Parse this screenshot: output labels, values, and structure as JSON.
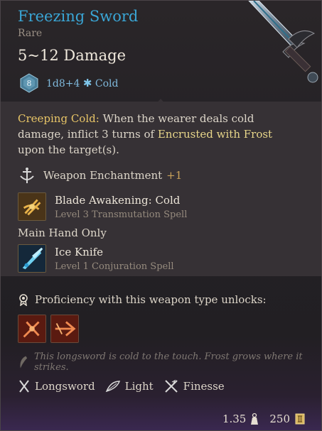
{
  "item": {
    "name": "Freezing Sword",
    "rarity": "Rare",
    "damage": "5~12 Damage",
    "die_label": "8",
    "damage_dice": "1d8+4",
    "damage_type": "Cold",
    "name_color": "#3aa6d6"
  },
  "passive": {
    "title": "Creeping Cold:",
    "text_1": " When the wearer deals cold damage, inflict 3 turns of ",
    "condition": "Encrusted with Frost",
    "text_2": " upon the target(s)."
  },
  "enchantment": {
    "label": "Weapon Enchantment",
    "bonus": "+1"
  },
  "spells": [
    {
      "name": "Blade Awakening: Cold",
      "subtitle": "Level 3 Transmutation Spell"
    },
    {
      "name": "Ice Knife",
      "subtitle": "Level 1 Conjuration Spell"
    }
  ],
  "main_hand": "Main Hand Only",
  "proficiency": {
    "label": "Proficiency with this weapon type unlocks:"
  },
  "flavor": "This longsword is cold to the touch. Frost grows where it strikes.",
  "properties": [
    "Longsword",
    "Light",
    "Finesse"
  ],
  "footer": {
    "weight": "1.35",
    "value": "250"
  },
  "icons": {
    "die": "d8-die-icon",
    "enchant": "weapon-enchantment-icon",
    "spell1": "blade-awakening-icon",
    "spell2": "ice-knife-icon",
    "prof": "proficiency-icon",
    "flavor": "quill-icon",
    "weight": "weight-icon",
    "gold": "gold-coin-icon"
  }
}
